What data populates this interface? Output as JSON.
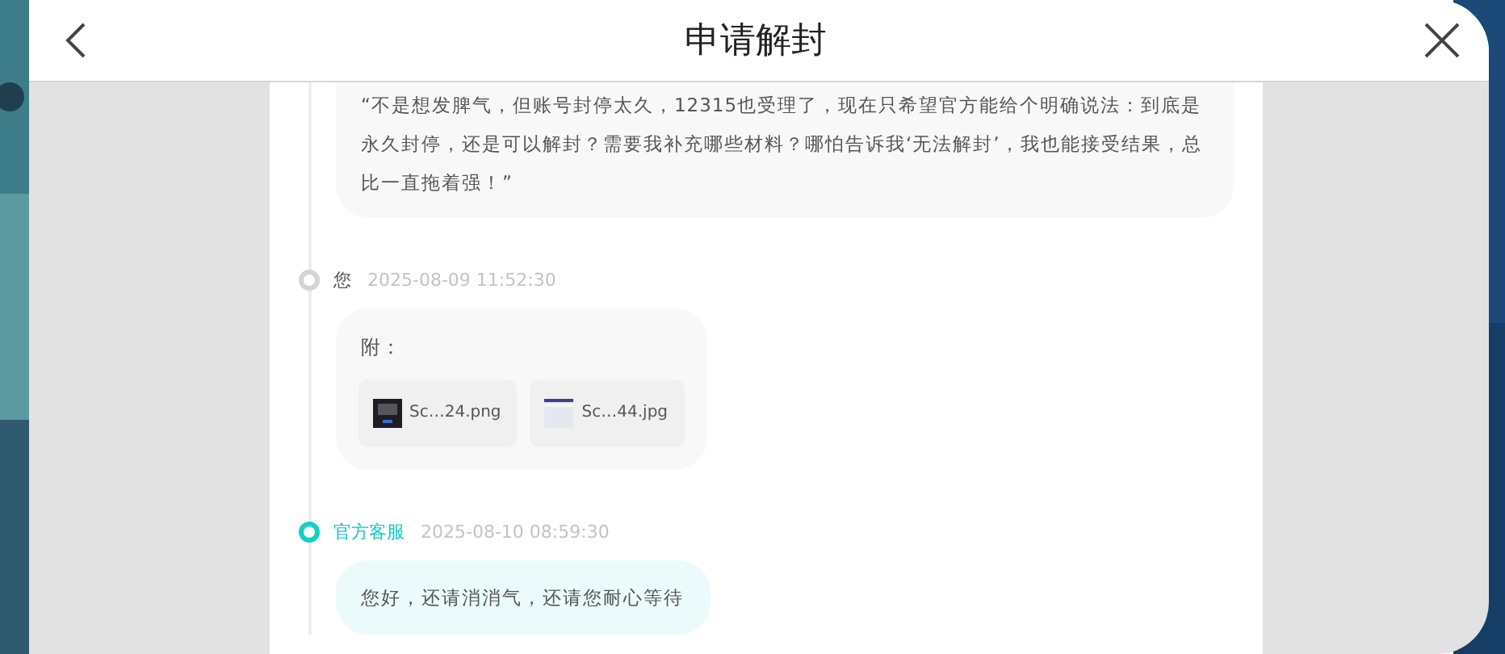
{
  "header": {
    "title": "申请解封"
  },
  "messages": [
    {
      "kind": "user",
      "text": "“不是想发脾气，但账号封停太久，12315也受理了，现在只希望官方能给个明确说法：到底是永久封停，还是可以解封？需要我补充哪些材料？哪怕告诉我‘无法解封’，我也能接受结果，总比一直拖着强！”"
    },
    {
      "kind": "user",
      "sender": "您",
      "time": "2025-08-09 11:52:30",
      "text": "附：",
      "attachments": [
        {
          "name": "Sc…24.png",
          "kind": "dark"
        },
        {
          "name": "Sc…44.jpg",
          "kind": "light"
        }
      ]
    },
    {
      "kind": "official",
      "sender": "官方客服",
      "time": "2025-08-10 08:59:30",
      "text": "您好，还请消消气，还请您耐心等待"
    }
  ]
}
